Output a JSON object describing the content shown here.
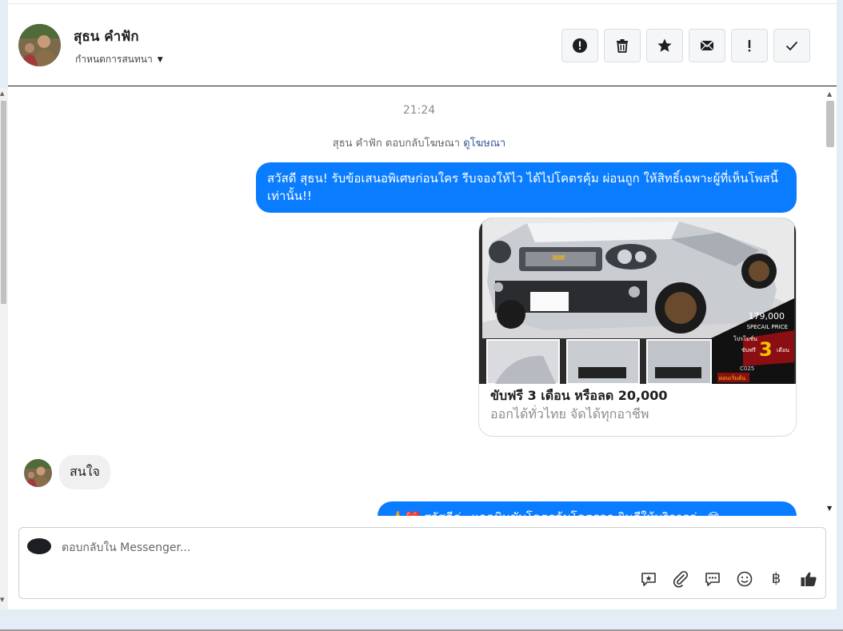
{
  "header": {
    "contact_name": "สุธน คำฟัก",
    "assign_label": "กำหนดการสนทนา",
    "actions": [
      {
        "icon": "alert-circle-icon"
      },
      {
        "icon": "trash-icon"
      },
      {
        "icon": "star-icon"
      },
      {
        "icon": "envelope-icon"
      },
      {
        "icon": "exclamation-icon"
      },
      {
        "icon": "check-icon"
      }
    ]
  },
  "chat": {
    "timestamp": "21:24",
    "reply_note": "สุธน คำฟัก ตอบกลับโฆษณา",
    "reply_link": "ดูโฆษณา",
    "outgoing_message": "สวัสดี สุธน! รับข้อเสนอพิเศษก่อนใคร รีบจองให้ไว ได้ไปโคตรคุ้ม ผ่อนถูก ให้สิทธิ์เฉพาะผู้ที่เห็นโพสนี้เท่านั้น!!",
    "ad_card": {
      "title": "ขับฟรี 3 เดือน หรือลด 20,000",
      "subtitle": "ออกได้ทั่วไทย จัดได้ทุกอาชีพ",
      "price": "179,000",
      "price_label": "SPECAIL PRICE",
      "promo_label": "โปรโมชั่น",
      "promo_sub": "ขับฟรี",
      "promo_number": "3",
      "promo_unit": "เดือน",
      "code": "C025",
      "badge": "ผ่อนเริ่มต้น"
    },
    "incoming_message": "สนใจ",
    "outgoing_message_2": "🙏❤️ สวัสดีค่ะ แอดมินขับโคตรคุ้มโคตรถูก ยินดีให้บริการค่ะ 😊"
  },
  "composer": {
    "placeholder": "ตอบกลับใน Messenger...",
    "tools": [
      "quick-reply-icon",
      "attachment-icon",
      "saved-replies-icon",
      "emoji-icon",
      "baht-icon",
      "thumbs-up-icon"
    ],
    "baht_symbol": "฿"
  },
  "colors": {
    "outgoing_bubble": "#0a7cff",
    "incoming_bubble": "#f0f0f0",
    "link": "#385898"
  }
}
